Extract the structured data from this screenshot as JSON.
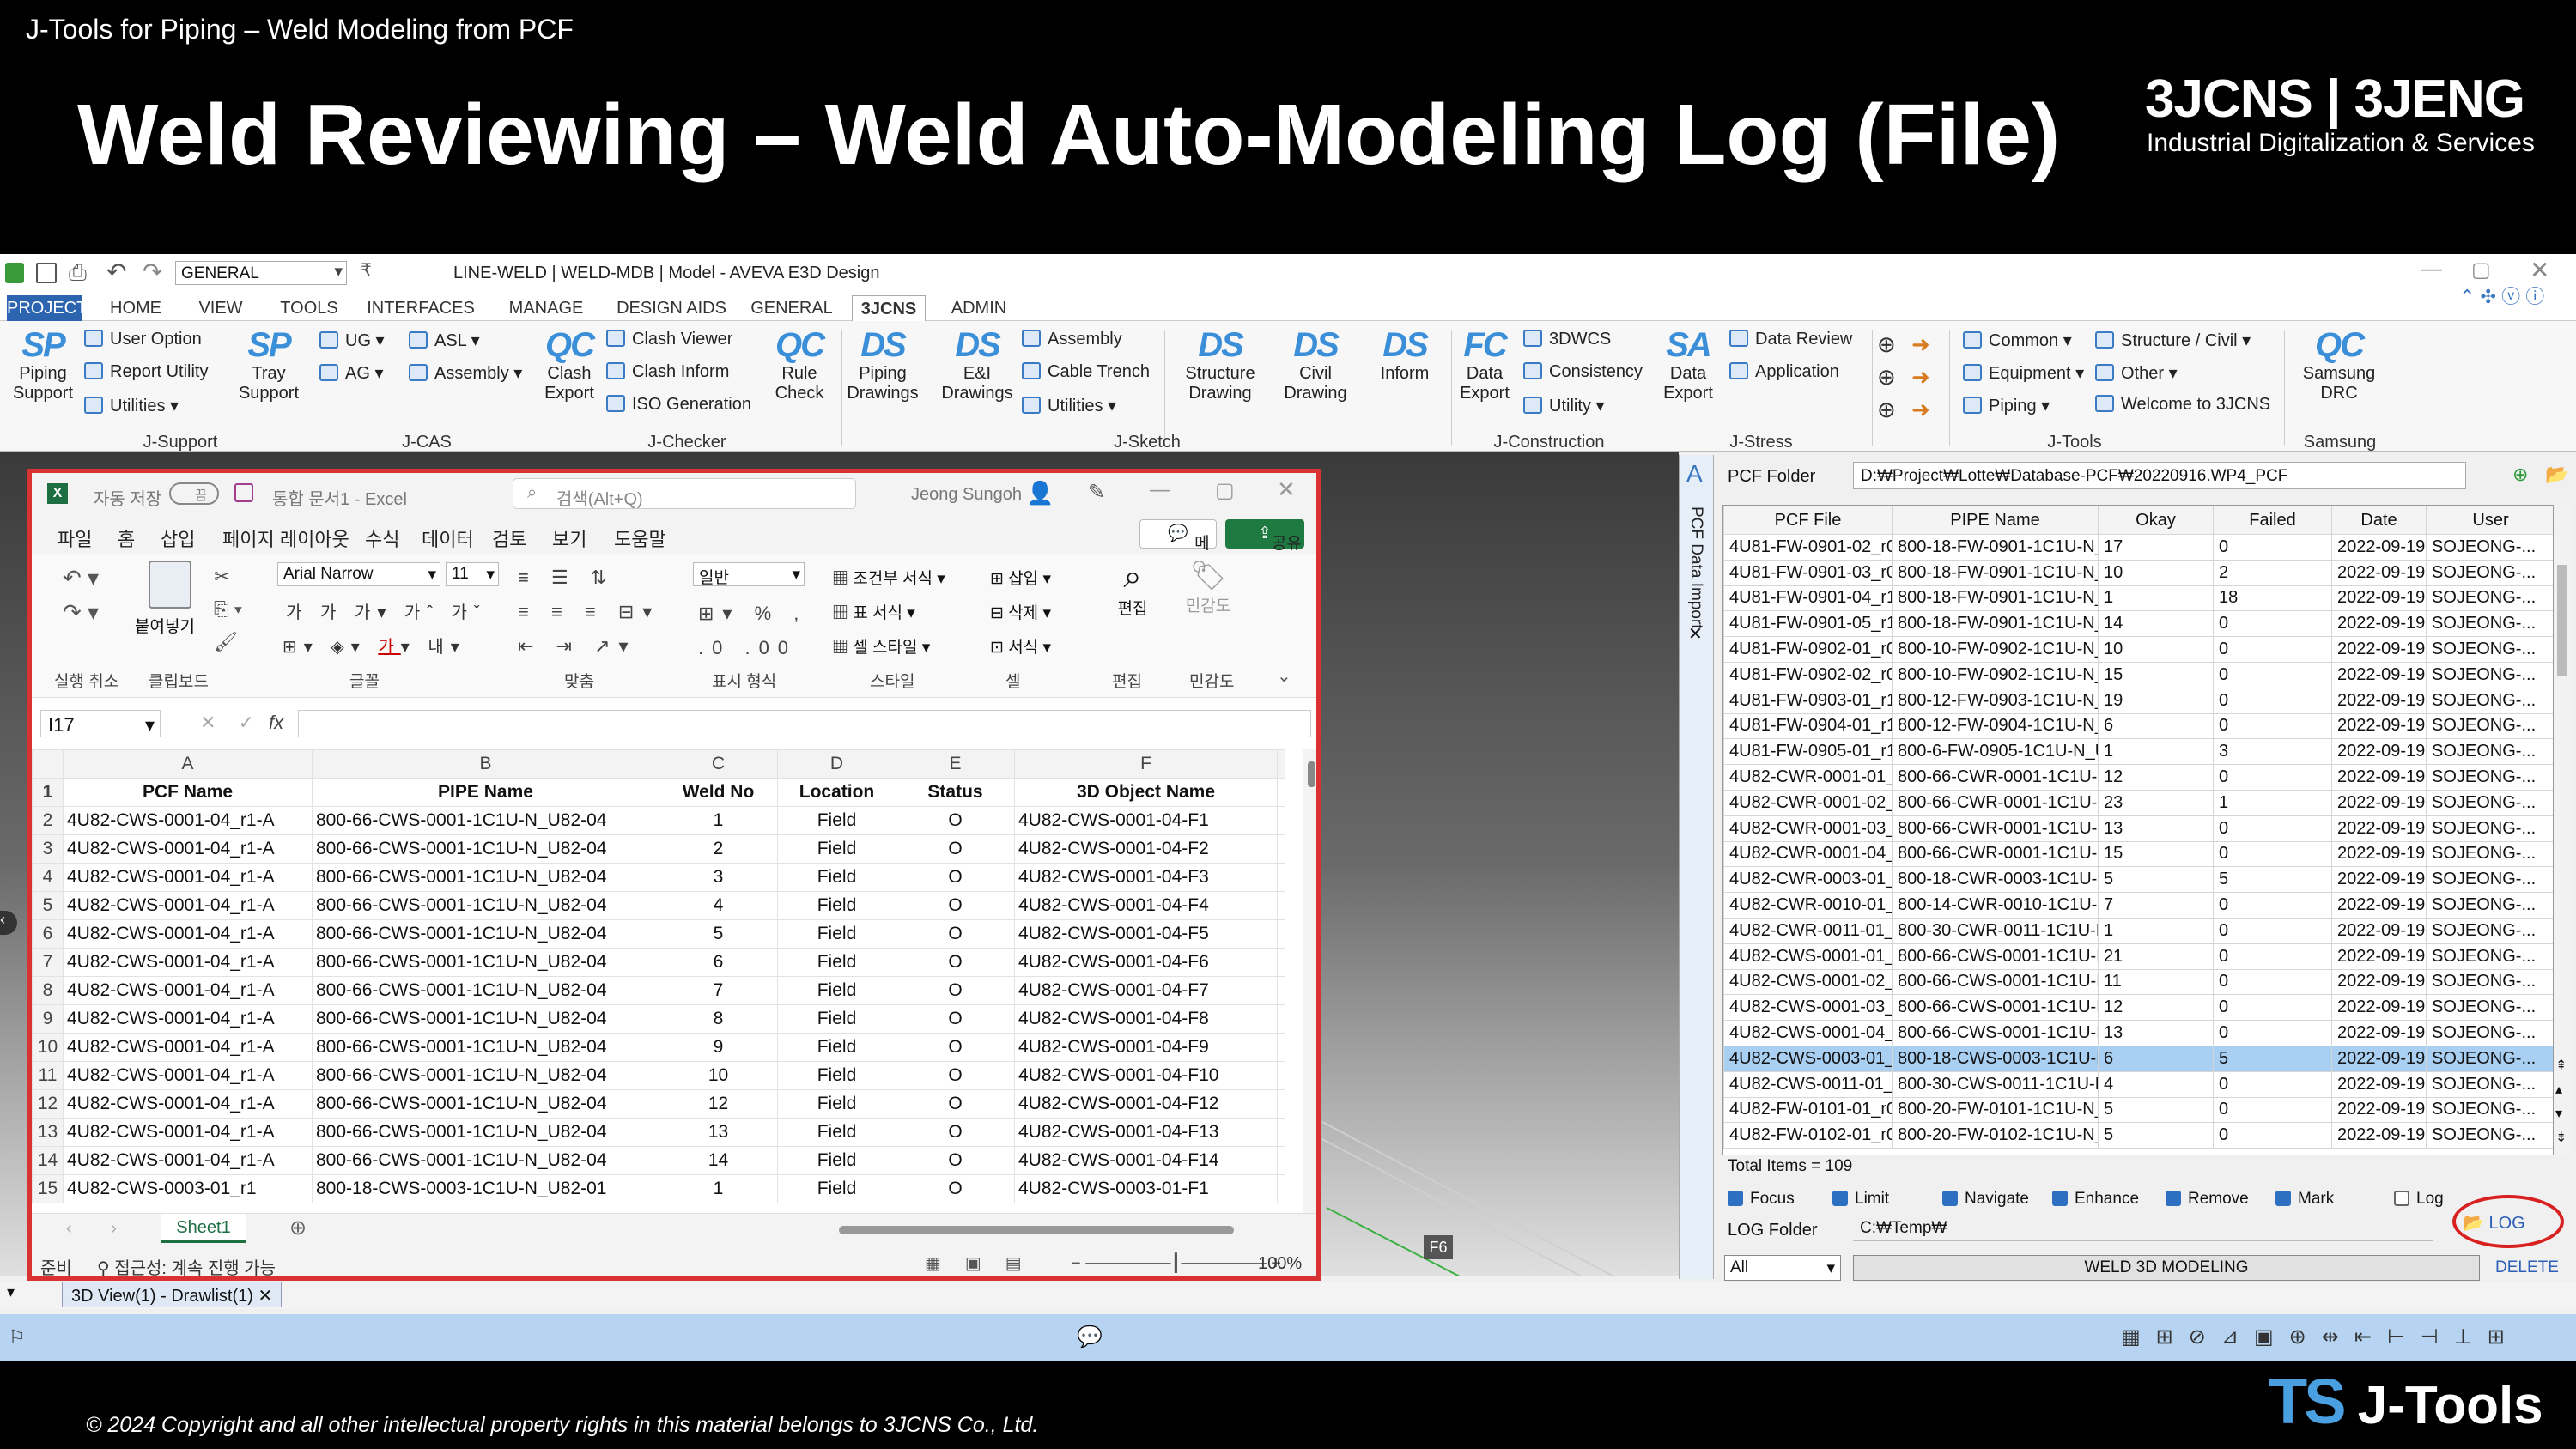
{
  "slide": {
    "top_label": "J-Tools for Piping – Weld Modeling from PCF",
    "title": "Weld Reviewing – Weld Auto-Modeling Log (File)",
    "logo_main": "3JCNS | 3JENG",
    "logo_sub": "Industrial Digitalization & Services",
    "footer": "© 2024 Copyright and all other intellectual property rights in this material belongs to 3JCNS Co., Ltd.",
    "brand_ts": "TS",
    "brand_name": "J-Tools"
  },
  "app": {
    "window_title": "LINE-WELD | WELD-MDB | Model - AVEVA E3D Design",
    "quick_combo": "GENERAL",
    "menu_tabs": [
      "PROJECT",
      "HOME",
      "VIEW",
      "TOOLS",
      "INTERFACES",
      "MANAGE",
      "DESIGN AIDS",
      "GENERAL",
      "3JCNS",
      "ADMIN"
    ],
    "ribbon": {
      "piping_support": "Piping\nSupport",
      "user_option": "User Option",
      "report_utility": "Report Utility",
      "utilities": "Utilities",
      "tray_support": "Tray\nSupport",
      "group_jsupport": "J-Support",
      "ug": "UG",
      "ag": "AG",
      "asl": "ASL",
      "assembly": "Assembly",
      "group_jcas": "J-CAS",
      "clash_export": "Clash\nExport",
      "clash_viewer": "Clash Viewer",
      "clash_inform": "Clash Inform",
      "iso_generation": "ISO Generation",
      "group_jchecker": "J-Checker",
      "rule_check": "Rule\nCheck",
      "piping_drawings": "Piping\nDrawings",
      "ei_drawings": "E&I\nDrawings",
      "assembly2": "Assembly",
      "cable_trench": "Cable Trench",
      "utilities2": "Utilities",
      "structure_drawing": "Structure\nDrawing",
      "civil_drawing": "Civil\nDrawing",
      "inform": "Inform",
      "group_jsketch": "J-Sketch",
      "data_export": "Data\nExport",
      "3dwcs": "3DWCS",
      "consistency": "Consistency",
      "utility": "Utility",
      "group_jconstruction": "J-Construction",
      "data_export2": "Data\nExport",
      "data_review": "Data Review",
      "application": "Application",
      "group_jstress": "J-Stress",
      "common": "Common",
      "equipment": "Equipment",
      "piping": "Piping",
      "structure_civil": "Structure / Civil",
      "other": "Other",
      "welcome": "Welcome to 3JCNS",
      "group_jtools": "J-Tools",
      "samsung_drc": "Samsung\nDRC",
      "group_samsung": "Samsung"
    },
    "view_tab": "3D View(1) - Drawlist(1)",
    "viewport_tag": "F6"
  },
  "excel": {
    "autosave": "자동 저장",
    "autosave_state": "끔",
    "doc_name": "통합 문서1 - Excel",
    "search_placeholder": "검색(Alt+Q)",
    "user": "Jeong Sungoh",
    "menu": [
      "파일",
      "홈",
      "삽입",
      "페이지 레이아웃",
      "수식",
      "데이터",
      "검토",
      "보기",
      "도움말"
    ],
    "memo": "메모",
    "share": "공유",
    "font_name": "Arial Narrow",
    "font_size": "11",
    "number_format": "일반",
    "groups": [
      "실행 취소",
      "클립보드",
      "글꼴",
      "맞춤",
      "표시 형식",
      "스타일",
      "셀",
      "편집",
      "민감도"
    ],
    "ribbon_labels": {
      "paste": "붙여넣기",
      "cond": "조건부 서식",
      "table": "표 서식",
      "cellstyle": "셀 스타일",
      "insert": "삽입",
      "delete": "삭제",
      "format": "서식",
      "edit": "편집",
      "sens": "민감도"
    },
    "cell_ref": "I17",
    "fx": "fx",
    "columns": [
      "A",
      "B",
      "C",
      "D",
      "E",
      "F"
    ],
    "header": [
      "PCF Name",
      "PIPE Name",
      "Weld No",
      "Location",
      "Status",
      "3D Object Name"
    ],
    "rows": [
      [
        "2",
        "4U82-CWS-0001-04_r1-A",
        "800-66-CWS-0001-1C1U-N_U82-04",
        "1",
        "Field",
        "O",
        "4U82-CWS-0001-04-F1"
      ],
      [
        "3",
        "4U82-CWS-0001-04_r1-A",
        "800-66-CWS-0001-1C1U-N_U82-04",
        "2",
        "Field",
        "O",
        "4U82-CWS-0001-04-F2"
      ],
      [
        "4",
        "4U82-CWS-0001-04_r1-A",
        "800-66-CWS-0001-1C1U-N_U82-04",
        "3",
        "Field",
        "O",
        "4U82-CWS-0001-04-F3"
      ],
      [
        "5",
        "4U82-CWS-0001-04_r1-A",
        "800-66-CWS-0001-1C1U-N_U82-04",
        "4",
        "Field",
        "O",
        "4U82-CWS-0001-04-F4"
      ],
      [
        "6",
        "4U82-CWS-0001-04_r1-A",
        "800-66-CWS-0001-1C1U-N_U82-04",
        "5",
        "Field",
        "O",
        "4U82-CWS-0001-04-F5"
      ],
      [
        "7",
        "4U82-CWS-0001-04_r1-A",
        "800-66-CWS-0001-1C1U-N_U82-04",
        "6",
        "Field",
        "O",
        "4U82-CWS-0001-04-F6"
      ],
      [
        "8",
        "4U82-CWS-0001-04_r1-A",
        "800-66-CWS-0001-1C1U-N_U82-04",
        "7",
        "Field",
        "O",
        "4U82-CWS-0001-04-F7"
      ],
      [
        "9",
        "4U82-CWS-0001-04_r1-A",
        "800-66-CWS-0001-1C1U-N_U82-04",
        "8",
        "Field",
        "O",
        "4U82-CWS-0001-04-F8"
      ],
      [
        "10",
        "4U82-CWS-0001-04_r1-A",
        "800-66-CWS-0001-1C1U-N_U82-04",
        "9",
        "Field",
        "O",
        "4U82-CWS-0001-04-F9"
      ],
      [
        "11",
        "4U82-CWS-0001-04_r1-A",
        "800-66-CWS-0001-1C1U-N_U82-04",
        "10",
        "Field",
        "O",
        "4U82-CWS-0001-04-F10"
      ],
      [
        "12",
        "4U82-CWS-0001-04_r1-A",
        "800-66-CWS-0001-1C1U-N_U82-04",
        "12",
        "Field",
        "O",
        "4U82-CWS-0001-04-F12"
      ],
      [
        "13",
        "4U82-CWS-0001-04_r1-A",
        "800-66-CWS-0001-1C1U-N_U82-04",
        "13",
        "Field",
        "O",
        "4U82-CWS-0001-04-F13"
      ],
      [
        "14",
        "4U82-CWS-0001-04_r1-A",
        "800-66-CWS-0001-1C1U-N_U82-04",
        "14",
        "Field",
        "O",
        "4U82-CWS-0001-04-F14"
      ],
      [
        "15",
        "4U82-CWS-0003-01_r1",
        "800-18-CWS-0003-1C1U-N_U82-01",
        "1",
        "Field",
        "O",
        "4U82-CWS-0003-01-F1"
      ]
    ],
    "sheet_tab": "Sheet1",
    "status_ready": "준비",
    "status_access": "접근성: 계속 진행 가능",
    "zoom": "100%"
  },
  "pcf": {
    "side_title": "PCF Data Import",
    "folder_label": "PCF Folder",
    "folder_path": "D:₩Project₩Lotte₩Database-PCF₩20220916.WP4_PCF",
    "columns": [
      "PCF File",
      "PIPE Name",
      "Okay",
      "Failed",
      "Date",
      "User"
    ],
    "rows": [
      [
        "4U81-FW-0901-02_r0",
        "800-18-FW-0901-1C1U-N_U...",
        "17",
        "0",
        "2022-09-19...",
        "SOJEONG-..."
      ],
      [
        "4U81-FW-0901-03_r0",
        "800-18-FW-0901-1C1U-N_U...",
        "10",
        "2",
        "2022-09-19...",
        "SOJEONG-..."
      ],
      [
        "4U81-FW-0901-04_r1",
        "800-18-FW-0901-1C1U-N_U...",
        "1",
        "18",
        "2022-09-19...",
        "SOJEONG-..."
      ],
      [
        "4U81-FW-0901-05_r1",
        "800-18-FW-0901-1C1U-N_U...",
        "14",
        "0",
        "2022-09-19...",
        "SOJEONG-..."
      ],
      [
        "4U81-FW-0902-01_r0",
        "800-10-FW-0902-1C1U-N_U...",
        "10",
        "0",
        "2022-09-19...",
        "SOJEONG-..."
      ],
      [
        "4U81-FW-0902-02_r0",
        "800-10-FW-0902-1C1U-N_U...",
        "15",
        "0",
        "2022-09-19...",
        "SOJEONG-..."
      ],
      [
        "4U81-FW-0903-01_r1",
        "800-12-FW-0903-1C1U-N_U...",
        "19",
        "0",
        "2022-09-19...",
        "SOJEONG-..."
      ],
      [
        "4U81-FW-0904-01_r1",
        "800-12-FW-0904-1C1U-N_U...",
        "6",
        "0",
        "2022-09-19...",
        "SOJEONG-..."
      ],
      [
        "4U81-FW-0905-01_r1",
        "800-6-FW-0905-1C1U-N_U8...",
        "1",
        "3",
        "2022-09-19...",
        "SOJEONG-..."
      ],
      [
        "4U82-CWR-0001-01_r1",
        "800-66-CWR-0001-1C1U-N_...",
        "12",
        "0",
        "2022-09-19...",
        "SOJEONG-..."
      ],
      [
        "4U82-CWR-0001-02_r...",
        "800-66-CWR-0001-1C1U-N_...",
        "23",
        "1",
        "2022-09-19...",
        "SOJEONG-..."
      ],
      [
        "4U82-CWR-0001-03_r...",
        "800-66-CWR-0001-1C1U-N_...",
        "13",
        "0",
        "2022-09-19...",
        "SOJEONG-..."
      ],
      [
        "4U82-CWR-0001-04_r...",
        "800-66-CWR-0001-1C1U-N_...",
        "15",
        "0",
        "2022-09-19...",
        "SOJEONG-..."
      ],
      [
        "4U82-CWR-0003-01_r1",
        "800-18-CWR-0003-1C1U-N_...",
        "5",
        "5",
        "2022-09-19...",
        "SOJEONG-..."
      ],
      [
        "4U82-CWR-0010-01_r1",
        "800-14-CWR-0010-1C1U-N_...",
        "7",
        "0",
        "2022-09-19...",
        "SOJEONG-..."
      ],
      [
        "4U82-CWR-0011-01_r...",
        "800-30-CWR-0011-1C1U-N_...",
        "1",
        "0",
        "2022-09-19...",
        "SOJEONG-..."
      ],
      [
        "4U82-CWS-0001-01_r...",
        "800-66-CWS-0001-1C1U-N_...",
        "21",
        "0",
        "2022-09-19...",
        "SOJEONG-..."
      ],
      [
        "4U82-CWS-0001-02_r...",
        "800-66-CWS-0001-1C1U-N_...",
        "11",
        "0",
        "2022-09-19...",
        "SOJEONG-..."
      ],
      [
        "4U82-CWS-0001-03_r2",
        "800-66-CWS-0001-1C1U-N_...",
        "12",
        "0",
        "2022-09-19...",
        "SOJEONG-..."
      ],
      [
        "4U82-CWS-0001-04_r...",
        "800-66-CWS-0001-1C1U-N_...",
        "13",
        "0",
        "2022-09-19...",
        "SOJEONG-..."
      ],
      [
        "4U82-CWS-0003-01_r1",
        "800-18-CWS-0003-1C1U-N_...",
        "6",
        "5",
        "2022-09-19...",
        "SOJEONG-..."
      ],
      [
        "4U82-CWS-0011-01_r0",
        "800-30-CWS-0011-1C1U-N_...",
        "4",
        "0",
        "2022-09-19...",
        "SOJEONG-..."
      ],
      [
        "4U82-FW-0101-01_r0",
        "800-20-FW-0101-1C1U-N_U...",
        "5",
        "0",
        "2022-09-19...",
        "SOJEONG-..."
      ],
      [
        "4U82-FW-0102-01_r0",
        "800-20-FW-0102-1C1U-N_U...",
        "5",
        "0",
        "2022-09-19...",
        "SOJEONG-..."
      ]
    ],
    "selected_index": 20,
    "total": "Total Items = 109",
    "options": [
      {
        "label": "Focus",
        "checked": true
      },
      {
        "label": "Limit",
        "checked": true
      },
      {
        "label": "Navigate",
        "checked": true
      },
      {
        "label": "Enhance",
        "checked": true
      },
      {
        "label": "Remove",
        "checked": true
      },
      {
        "label": "Mark",
        "checked": true
      },
      {
        "label": "Log",
        "checked": false
      }
    ],
    "log_folder_label": "LOG Folder",
    "log_folder_path": "C:₩Temp₩",
    "log_button": "LOG",
    "filter_value": "All",
    "weld_button": "WELD 3D MODELING",
    "delete_button": "DELETE",
    "highlight_color": "#d92020"
  }
}
